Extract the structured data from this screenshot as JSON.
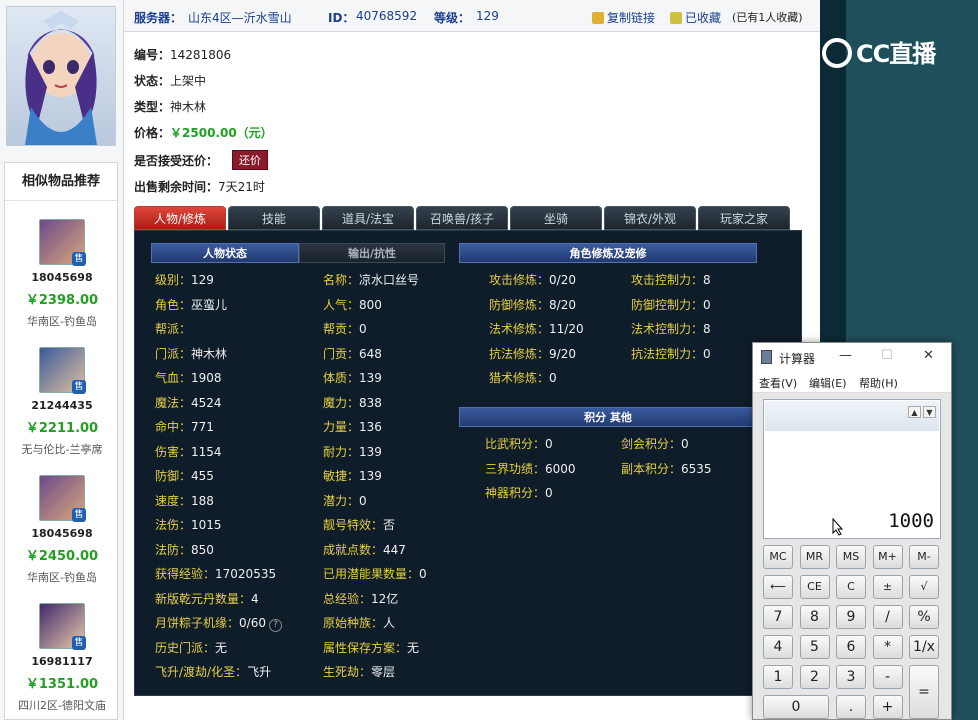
{
  "topbar": {
    "server_label": "服务器：",
    "server_value": "山东4区—沂水雪山",
    "id_label": "ID：",
    "id_value": "40768592",
    "level_label": "等级：",
    "level_value": "129",
    "copy_link": "复制链接",
    "favorited": "已收藏",
    "fav_count": "(已有1人收藏)"
  },
  "info": {
    "number_label": "编号：",
    "number_value": "14281806",
    "status_label": "状态：",
    "status_value": "上架中",
    "type_label": "类型：",
    "type_value": "神木林",
    "price_label": "价格：",
    "price_value": "￥2500.00（元）",
    "counter_label": "是否接受还价：",
    "counter_button": "还价",
    "remain_label": "出售剩余时间：",
    "remain_value": "7天21时"
  },
  "similar": {
    "title": "相似物品推荐",
    "sold_badge": "售",
    "items": [
      {
        "id": "18045698",
        "price": "￥2398.00",
        "server": "华南区-钓鱼岛"
      },
      {
        "id": "21244435",
        "price": "￥2211.00",
        "server": "无与伦比-兰亭席"
      },
      {
        "id": "18045698",
        "price": "￥2450.00",
        "server": "华南区-钓鱼岛"
      },
      {
        "id": "16981117",
        "price": "￥1351.00",
        "server": "四川2区-德阳文庙"
      }
    ]
  },
  "tabs": [
    "人物/修炼",
    "技能",
    "道具/法宝",
    "召唤兽/孩子",
    "坐骑",
    "锦衣/外观",
    "玩家之家"
  ],
  "panel": {
    "hdr_status": "人物状态",
    "hdr_output": "输出/抗性",
    "hdr_cultivation": "角色修炼及宠修",
    "hdr_points": "积分 其他",
    "left_col": [
      {
        "k": "级别：",
        "v": "129"
      },
      {
        "k": "角色：",
        "v": "巫蛮儿"
      },
      {
        "k": "帮派：",
        "v": ""
      },
      {
        "k": "门派：",
        "v": "神木林"
      },
      {
        "k": "气血：",
        "v": "1908"
      },
      {
        "k": "魔法：",
        "v": "4524"
      },
      {
        "k": "命中：",
        "v": "771"
      },
      {
        "k": "伤害：",
        "v": "1154"
      },
      {
        "k": "防御：",
        "v": "455"
      },
      {
        "k": "速度：",
        "v": "188"
      },
      {
        "k": "法伤：",
        "v": "1015"
      },
      {
        "k": "法防：",
        "v": "850"
      },
      {
        "k": "获得经验：",
        "v": "17020535"
      },
      {
        "k": "新版乾元丹数量：",
        "v": "4"
      },
      {
        "k": "月饼粽子机缘：",
        "v": "0/60"
      },
      {
        "k": "历史门派：",
        "v": "无"
      },
      {
        "k": "飞升/渡劫/化圣：",
        "v": "飞升"
      }
    ],
    "mid_col": [
      {
        "k": "名称：",
        "v": "凉水口丝号"
      },
      {
        "k": "人气：",
        "v": "800"
      },
      {
        "k": "帮贡：",
        "v": "0"
      },
      {
        "k": "门贡：",
        "v": "648"
      },
      {
        "k": "体质：",
        "v": "139"
      },
      {
        "k": "魔力：",
        "v": "838"
      },
      {
        "k": "力量：",
        "v": "136"
      },
      {
        "k": "耐力：",
        "v": "139"
      },
      {
        "k": "敏捷：",
        "v": "139"
      },
      {
        "k": "潜力：",
        "v": "0"
      },
      {
        "k": "靓号特效：",
        "v": "否"
      },
      {
        "k": "成就点数：",
        "v": "447"
      },
      {
        "k": "已用潜能果数量：",
        "v": "0"
      },
      {
        "k": "总经验：",
        "v": "12亿"
      },
      {
        "k": "原始种族：",
        "v": "人"
      },
      {
        "k": "属性保存方案：",
        "v": "无"
      },
      {
        "k": "生死劫：",
        "v": "零层"
      }
    ],
    "cultivation": [
      {
        "k": "攻击修炼：",
        "v": "0/20",
        "k2": "攻击控制力：",
        "v2": "8"
      },
      {
        "k": "防御修炼：",
        "v": "8/20",
        "k2": "防御控制力：",
        "v2": "0"
      },
      {
        "k": "法术修炼：",
        "v": "11/20",
        "k2": "法术控制力：",
        "v2": "8"
      },
      {
        "k": "抗法修炼：",
        "v": "9/20",
        "k2": "抗法控制力：",
        "v2": "0"
      },
      {
        "k": "猎术修炼：",
        "v": "0",
        "k2": "",
        "v2": ""
      }
    ],
    "points": [
      {
        "k": "比武积分：",
        "v": "0",
        "k2": "剑会积分：",
        "v2": "0"
      },
      {
        "k": "三界功绩：",
        "v": "6000",
        "k2": "副本积分：",
        "v2": "6535"
      },
      {
        "k": "神器积分：",
        "v": "0",
        "k2": "",
        "v2": ""
      }
    ]
  },
  "logo": "CC直播",
  "calculator": {
    "title": "计算器",
    "menu": [
      "查看(V)",
      "编辑(E)",
      "帮助(H)"
    ],
    "display": "1000",
    "keys": [
      [
        "MC",
        "MR",
        "MS",
        "M+",
        "M-"
      ],
      [
        "⟵",
        "CE",
        "C",
        "±",
        "√"
      ],
      [
        "7",
        "8",
        "9",
        "/",
        "%"
      ],
      [
        "4",
        "5",
        "6",
        "*",
        "1/x"
      ],
      [
        "1",
        "2",
        "3",
        "-",
        "="
      ],
      [
        "0",
        ".",
        "+"
      ]
    ],
    "win_min": "—",
    "win_max": "☐",
    "win_close": "✕"
  }
}
